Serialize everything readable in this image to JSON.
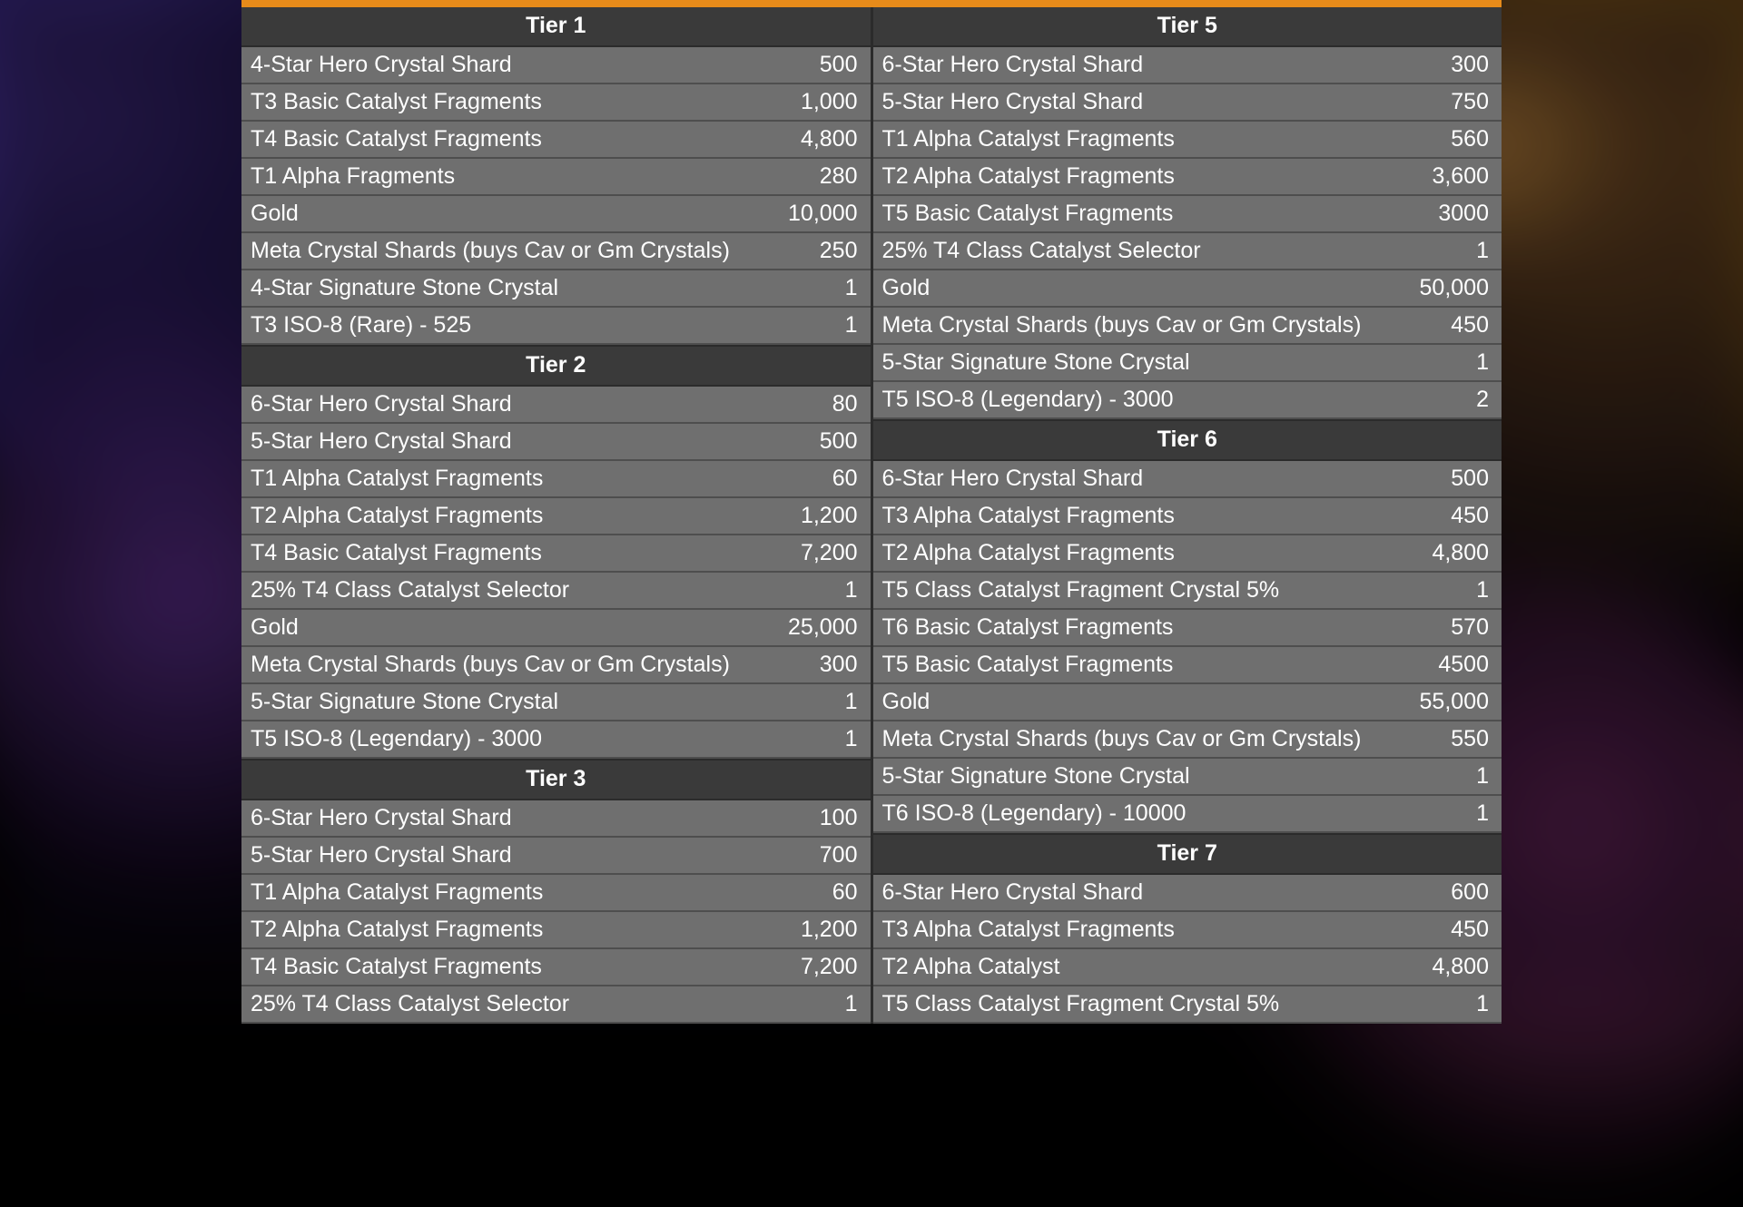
{
  "colors": {
    "accent": "#e78b1a",
    "header_bg": "#3a3a3a",
    "row_bg": "#6f6f6f"
  },
  "left": [
    {
      "title": "Tier 1",
      "rows": [
        {
          "name": "4-Star Hero Crystal Shard",
          "value": "500"
        },
        {
          "name": "T3 Basic Catalyst Fragments",
          "value": "1,000"
        },
        {
          "name": "T4 Basic Catalyst Fragments",
          "value": "4,800"
        },
        {
          "name": "T1 Alpha Fragments",
          "value": "280"
        },
        {
          "name": "Gold",
          "value": "10,000"
        },
        {
          "name": "Meta Crystal Shards (buys Cav or Gm Crystals)",
          "value": "250"
        },
        {
          "name": "4-Star Signature Stone Crystal",
          "value": "1"
        },
        {
          "name": "T3 ISO-8 (Rare) - 525",
          "value": "1"
        }
      ]
    },
    {
      "title": "Tier 2",
      "rows": [
        {
          "name": "6-Star Hero Crystal Shard",
          "value": "80"
        },
        {
          "name": "5-Star Hero Crystal Shard",
          "value": "500"
        },
        {
          "name": "T1 Alpha Catalyst Fragments",
          "value": "60"
        },
        {
          "name": "T2 Alpha Catalyst Fragments",
          "value": "1,200"
        },
        {
          "name": "T4 Basic Catalyst Fragments",
          "value": "7,200"
        },
        {
          "name": "25% T4 Class Catalyst Selector",
          "value": "1"
        },
        {
          "name": "Gold",
          "value": "25,000"
        },
        {
          "name": "Meta Crystal Shards (buys Cav or Gm Crystals)",
          "value": "300"
        },
        {
          "name": "5-Star Signature Stone Crystal",
          "value": "1"
        },
        {
          "name": "T5 ISO-8 (Legendary) - 3000",
          "value": "1"
        }
      ]
    },
    {
      "title": "Tier 3",
      "rows": [
        {
          "name": "6-Star Hero Crystal Shard",
          "value": "100"
        },
        {
          "name": "5-Star Hero Crystal Shard",
          "value": "700"
        },
        {
          "name": "T1 Alpha Catalyst Fragments",
          "value": "60"
        },
        {
          "name": "T2 Alpha Catalyst Fragments",
          "value": "1,200"
        },
        {
          "name": "T4 Basic Catalyst Fragments",
          "value": "7,200"
        },
        {
          "name": "25% T4 Class Catalyst Selector",
          "value": "1"
        }
      ]
    }
  ],
  "right": [
    {
      "title": "Tier 5",
      "rows": [
        {
          "name": "6-Star Hero Crystal Shard",
          "value": "300"
        },
        {
          "name": "5-Star Hero Crystal Shard",
          "value": "750"
        },
        {
          "name": "T1 Alpha Catalyst Fragments",
          "value": "560"
        },
        {
          "name": "T2 Alpha Catalyst Fragments",
          "value": "3,600"
        },
        {
          "name": "T5 Basic Catalyst Fragments",
          "value": "3000"
        },
        {
          "name": "25% T4 Class Catalyst Selector",
          "value": "1"
        },
        {
          "name": "Gold",
          "value": "50,000"
        },
        {
          "name": "Meta Crystal Shards (buys Cav or Gm Crystals)",
          "value": "450"
        },
        {
          "name": "5-Star Signature Stone Crystal",
          "value": "1"
        },
        {
          "name": "T5 ISO-8 (Legendary) - 3000",
          "value": "2"
        }
      ]
    },
    {
      "title": "Tier 6",
      "rows": [
        {
          "name": "6-Star Hero Crystal Shard",
          "value": "500"
        },
        {
          "name": "T3 Alpha Catalyst Fragments",
          "value": "450"
        },
        {
          "name": "T2 Alpha Catalyst Fragments",
          "value": "4,800"
        },
        {
          "name": "T5 Class Catalyst Fragment Crystal 5%",
          "value": "1"
        },
        {
          "name": "T6 Basic Catalyst Fragments",
          "value": "570"
        },
        {
          "name": "T5 Basic Catalyst Fragments",
          "value": "4500"
        },
        {
          "name": "Gold",
          "value": "55,000"
        },
        {
          "name": "Meta Crystal Shards (buys Cav or Gm Crystals)",
          "value": "550"
        },
        {
          "name": "5-Star Signature Stone Crystal",
          "value": "1"
        },
        {
          "name": "T6 ISO-8 (Legendary) - 10000",
          "value": "1"
        }
      ]
    },
    {
      "title": "Tier 7",
      "rows": [
        {
          "name": "6-Star Hero Crystal Shard",
          "value": "600"
        },
        {
          "name": "T3 Alpha Catalyst Fragments",
          "value": "450"
        },
        {
          "name": "T2 Alpha Catalyst",
          "value": "4,800"
        },
        {
          "name": "T5 Class Catalyst Fragment Crystal 5%",
          "value": "1"
        }
      ]
    }
  ]
}
